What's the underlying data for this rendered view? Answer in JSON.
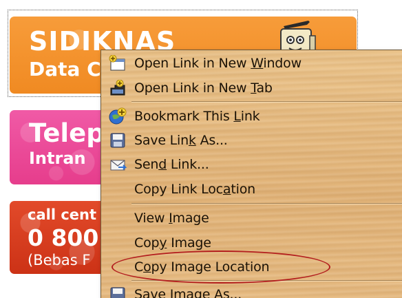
{
  "banners": [
    {
      "line1": "SIDIKNAS",
      "line2": "Data C"
    },
    {
      "line1": "Telep",
      "line2": "Intran"
    },
    {
      "line1": "call cent",
      "line2": "0 800",
      "line3": "(Bebas F"
    }
  ],
  "context_menu": {
    "items": [
      {
        "id": "open-new-window",
        "pre": "Open Link in New ",
        "key": "W",
        "post": "indow",
        "icon": "new-window-icon"
      },
      {
        "id": "open-new-tab",
        "pre": "Open Link in New ",
        "key": "T",
        "post": "ab",
        "icon": "new-tab-icon"
      },
      {
        "id": "bookmark-link",
        "pre": "Bookmark This ",
        "key": "L",
        "post": "ink",
        "icon": "bookmark-star-icon"
      },
      {
        "id": "save-link-as",
        "pre": "Save Lin",
        "key": "k",
        "post": " As...",
        "icon": "floppy-disk-icon"
      },
      {
        "id": "send-link",
        "pre": "Sen",
        "key": "d",
        "post": " Link...",
        "icon": "email-envelope-icon"
      },
      {
        "id": "copy-link-location",
        "pre": "Copy Link Loc",
        "key": "a",
        "post": "tion",
        "icon": ""
      },
      {
        "id": "view-image",
        "pre": "View ",
        "key": "I",
        "post": "mage",
        "icon": ""
      },
      {
        "id": "copy-image",
        "pre": "Cop",
        "key": "y",
        "post": " Image",
        "icon": ""
      },
      {
        "id": "copy-image-location",
        "pre": "C",
        "key": "o",
        "post": "py Image Location",
        "icon": ""
      },
      {
        "id": "save-image-as",
        "pre": "Sa",
        "key": "v",
        "post": "e Image As...",
        "icon": "save-image-icon"
      }
    ]
  },
  "colors": {
    "highlight_ellipse": "#b31e1e",
    "menu_wood": "#e6bb80"
  }
}
